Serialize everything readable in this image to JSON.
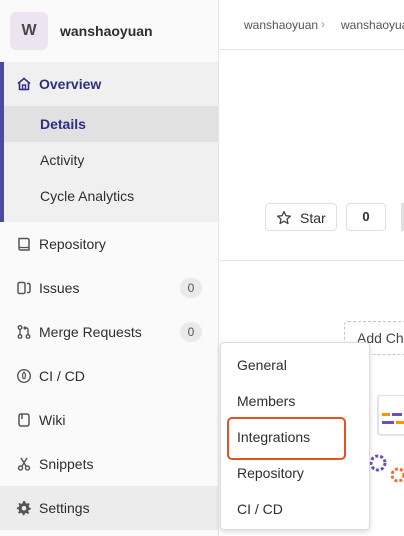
{
  "project": {
    "avatar_letter": "W",
    "name": "wanshaoyuan"
  },
  "sidebar": {
    "overview": {
      "label": "Overview",
      "sub_items": [
        {
          "label": "Details",
          "active": true
        },
        {
          "label": "Activity"
        },
        {
          "label": "Cycle Analytics"
        }
      ]
    },
    "items": [
      {
        "label": "Repository",
        "icon": "book-icon"
      },
      {
        "label": "Issues",
        "icon": "issues-icon",
        "count": "0"
      },
      {
        "label": "Merge Requests",
        "icon": "merge-request-icon",
        "count": "0"
      },
      {
        "label": "CI / CD",
        "icon": "rocket-icon"
      },
      {
        "label": "Wiki",
        "icon": "wiki-icon"
      },
      {
        "label": "Snippets",
        "icon": "scissors-icon"
      },
      {
        "label": "Settings",
        "icon": "gear-icon"
      }
    ]
  },
  "breadcrumb": {
    "first": "wanshaoyuan",
    "separator": "›",
    "second": "wanshaoyuan"
  },
  "star": {
    "label": "Star",
    "count": "0"
  },
  "add_changelog": "Add Changelog",
  "settings_menu": {
    "items": [
      "General",
      "Members",
      "Integrations",
      "Repository",
      "CI / CD"
    ],
    "highlighted": "Integrations",
    "highlight_color": "#e4521f"
  },
  "colors": {
    "accent": "#4b4ba3",
    "active_text": "#2e2e83"
  }
}
